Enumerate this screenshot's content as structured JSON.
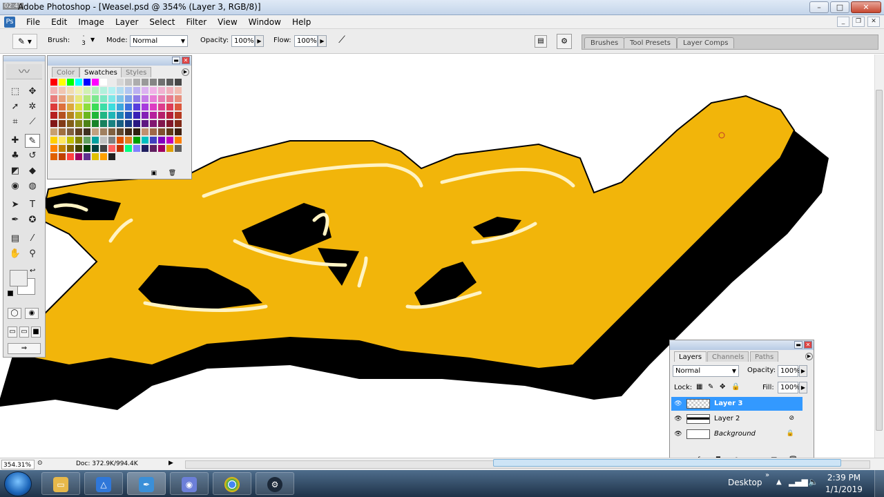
{
  "window": {
    "title": "Adobe Photoshop - [Weasel.psd @ 354% (Layer 3, RGB/8)]",
    "clock_overlay": "02:42",
    "buttons": [
      "–",
      "□",
      "✕"
    ]
  },
  "menu": {
    "items": [
      "File",
      "Edit",
      "Image",
      "Layer",
      "Select",
      "Filter",
      "View",
      "Window",
      "Help"
    ],
    "doc_controls": [
      "_",
      "❐",
      "✕"
    ]
  },
  "options": {
    "brush_label": "Brush:",
    "brush_size": "3",
    "mode_label": "Mode:",
    "mode_value": "Normal",
    "opacity_label": "Opacity:",
    "opacity_value": "100%",
    "flow_label": "Flow:",
    "flow_value": "100%",
    "palette_tabs": [
      "Brushes",
      "Tool Presets",
      "Layer Comps"
    ]
  },
  "swatches_panel": {
    "tabs": [
      "Color",
      "Swatches",
      "Styles"
    ],
    "active_tab": "Swatches"
  },
  "layers_panel": {
    "tabs": [
      "Layers",
      "Channels",
      "Paths"
    ],
    "blend_mode": "Normal",
    "opacity_label": "Opacity:",
    "opacity_value": "100%",
    "lock_label": "Lock:",
    "fill_label": "Fill:",
    "fill_value": "100%",
    "layers": [
      {
        "name": "Layer 3",
        "selected": true
      },
      {
        "name": "Layer 2",
        "selected": false
      },
      {
        "name": "Background",
        "selected": false,
        "locked": true
      }
    ]
  },
  "status": {
    "zoom": "354.31%",
    "doc_info": "Doc: 372.9K/994.4K"
  },
  "taskbar": {
    "desktop_label": "Desktop",
    "time": "2:39 PM",
    "date": "1/1/2019",
    "apps": [
      "windows-explorer",
      "google-drive",
      "photoshop",
      "discord",
      "chrome",
      "steam"
    ]
  },
  "colors": {
    "graffiti_fill": "#f2b50a",
    "graffiti_shadow": "#000000",
    "graffiti_highlight": "#fff3c4",
    "selection_blue": "#3399ff"
  }
}
